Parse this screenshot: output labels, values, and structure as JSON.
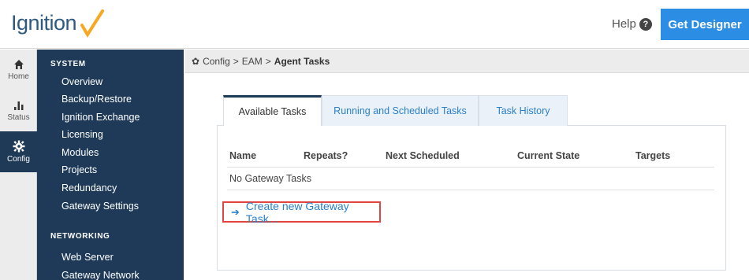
{
  "header": {
    "logo_text": "Ignition",
    "help_label": "Help",
    "help_icon": "question-circle-icon",
    "get_designer_label": "Get Designer",
    "accent_color": "#2b8de3"
  },
  "rail": {
    "items": [
      {
        "label": "Home",
        "icon": "home-icon"
      },
      {
        "label": "Status",
        "icon": "bar-chart-icon"
      },
      {
        "label": "Config",
        "icon": "gear-icon",
        "active": true
      }
    ]
  },
  "nav": {
    "sections": [
      {
        "title": "SYSTEM",
        "items": [
          "Overview",
          "Backup/Restore",
          "Ignition Exchange",
          "Licensing",
          "Modules",
          "Projects",
          "Redundancy",
          "Gateway Settings"
        ]
      },
      {
        "title": "NETWORKING",
        "items": [
          "Web Server",
          "Gateway Network"
        ]
      }
    ],
    "background_color": "#1e3a58"
  },
  "breadcrumb": {
    "icon": "gear-icon",
    "items": [
      "Config",
      "EAM",
      "Agent Tasks"
    ],
    "separator": ">"
  },
  "tabs": [
    {
      "label": "Available Tasks",
      "active": true
    },
    {
      "label": "Running and Scheduled Tasks",
      "active": false
    },
    {
      "label": "Task History",
      "active": false
    }
  ],
  "table": {
    "columns": [
      "Name",
      "Repeats?",
      "Next Scheduled",
      "Current State",
      "Targets"
    ],
    "empty_message": "No Gateway Tasks"
  },
  "create_link": {
    "icon": "arrow-right-icon",
    "label": "Create new Gateway Task..."
  },
  "highlight_color": "#e2453f"
}
